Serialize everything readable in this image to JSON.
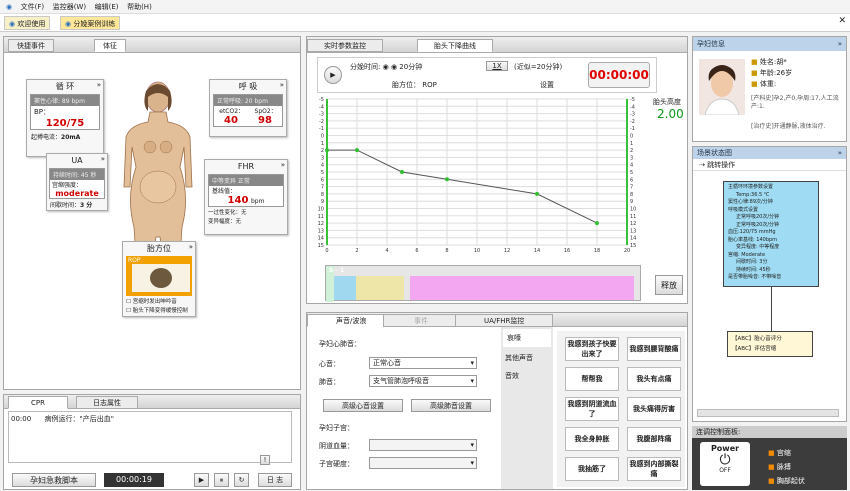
{
  "menu": {
    "file": "文件(F)",
    "monitor": "监控器(W)",
    "edit": "编辑(E)",
    "help": "帮助(H)"
  },
  "tabs": [
    "欢迎使用",
    "分娩案例训练"
  ],
  "left": {
    "tab_events": "快捷事件",
    "tab_signs": "体征",
    "circ": {
      "title": "循 环",
      "hr": "窦性心律: 89 bpm",
      "bp_label": "BP：",
      "bp": "120/75",
      "pace_label": "起搏电流：",
      "pace": "20mA"
    },
    "resp": {
      "title": "呼 吸",
      "rate": "正常呼吸: 20 bpm",
      "etco2_label": "etCO2：",
      "etco2": "40",
      "spo2_label": "SpO2：",
      "spo2": "98"
    },
    "ua": {
      "title": "UA",
      "interval": "持续时间: 45 秒",
      "strength_label": "宫缩强度：",
      "strength": "moderate",
      "gap_label": "间歇时间：",
      "gap": "3 分"
    },
    "fhr": {
      "title": "FHR",
      "variability": "中等变异  正常",
      "base_label": "基线值：",
      "base": "140",
      "unit": "bpm",
      "accel_label": "一过性变化：",
      "accel": "无",
      "decel_label": "变异幅度：",
      "decel": "无"
    },
    "pos": {
      "title": "胎方位",
      "label": "ROP",
      "opt1": "宫缩时发出呻吟音",
      "opt2": "胎头下降变得缓慢控制"
    }
  },
  "chart": {
    "tab_vitals": "实时参数监控",
    "tab_descent": "胎头下降曲线",
    "period_label": "分娩时间:",
    "period_value": "20分钟",
    "speed": "1X",
    "approx": "(近似=20分钟)",
    "timer": "00:00:00",
    "pos_label": "胎方位：",
    "pos_value": "ROP",
    "setting": "设置",
    "station_label": "胎头高度",
    "station_value": "2.00",
    "stage_label": "S - 1",
    "release": "释放"
  },
  "chart_data": {
    "type": "line",
    "x": [
      0,
      2,
      4,
      6,
      8,
      10,
      12,
      14,
      16,
      18,
      20
    ],
    "xticks": [
      0,
      2,
      4,
      6,
      8,
      10,
      12,
      14,
      16,
      18,
      20
    ],
    "yticks": [
      -5,
      -4,
      -3,
      -2,
      -1,
      0,
      1,
      2,
      3,
      4,
      5,
      6,
      7,
      8,
      9,
      10,
      11,
      12,
      13,
      14,
      15
    ],
    "ylim": [
      -5,
      15
    ],
    "xlim": [
      0,
      20
    ],
    "points": [
      [
        0,
        2
      ],
      [
        2,
        2
      ],
      [
        5,
        5
      ],
      [
        8,
        6
      ],
      [
        14,
        8
      ],
      [
        18,
        12
      ]
    ]
  },
  "sound": {
    "tab1": "声音/波浪",
    "tab2": "事件",
    "tab3": "UA/FHR监控",
    "maternal": "孕妇心肺音：",
    "heart_label": "心音：",
    "heart_value": "正常心音",
    "lung_label": "肺音：",
    "lung_value": "支气管肺泡呼吸音",
    "adv_heart": "高级心音设置",
    "adv_lung": "高级肺音设置",
    "uterus": "孕妇子宫：",
    "vagina_label": "阴道血量：",
    "cervix_label": "子宫硬度：",
    "cats": [
      "哀嚎",
      "其他声音",
      "音效"
    ],
    "voices": [
      "我感到孩子快要出来了",
      "我感到腰背酸痛",
      "帮帮我",
      "我头有点痛",
      "我感到阴道流血了",
      "我头痛得厉害",
      "我全身肿胀",
      "我腹部阵痛",
      "我抽筋了",
      "我感到内部撕裂痛"
    ]
  },
  "log": {
    "tab_cpr": "CPR",
    "tab_log": "日志属性",
    "time": "00:00",
    "text": "病例运行：\"产后出血\"",
    "script_btn": "孕妇急救脚本",
    "clock": "00:00:19",
    "log_btn": "日 志"
  },
  "info": {
    "title": "孕妇信息",
    "name": "姓名:胡*",
    "age": "年龄:26岁",
    "weight": "体重:",
    "hist1": "[产科史]孕2,产0,孕周:17,人工流产:1.",
    "hist2": "[治疗史]开通静脉,液体治疗."
  },
  "flow": {
    "title": "场景状态图",
    "op": "跳转操作",
    "node": [
      "主循环环境参数设置",
      "Temp:36.5 ℃",
      "窦性心律:89次/分钟",
      "呼吸模式设置",
      "正常呼吸20次/分钟",
      "正常呼吸20次/分钟",
      "血压:120/75 mmHg",
      "胎心率基线: 140bpm",
      "变异程度: 中等程度",
      "宫缩: Moderate",
      "间歇时间: 3分",
      "持续时间: 45秒",
      "是否带胎噪音: 不带噪音"
    ],
    "abc1": "【ABC】胎心音评分",
    "abc2": "【ABC】评估宫缩"
  },
  "ctrl": {
    "title": "连调控制面板:",
    "power": "Power",
    "off": "OFF",
    "i1": "宫缩",
    "i2": "脉搏",
    "i3": "胸部起伏"
  }
}
